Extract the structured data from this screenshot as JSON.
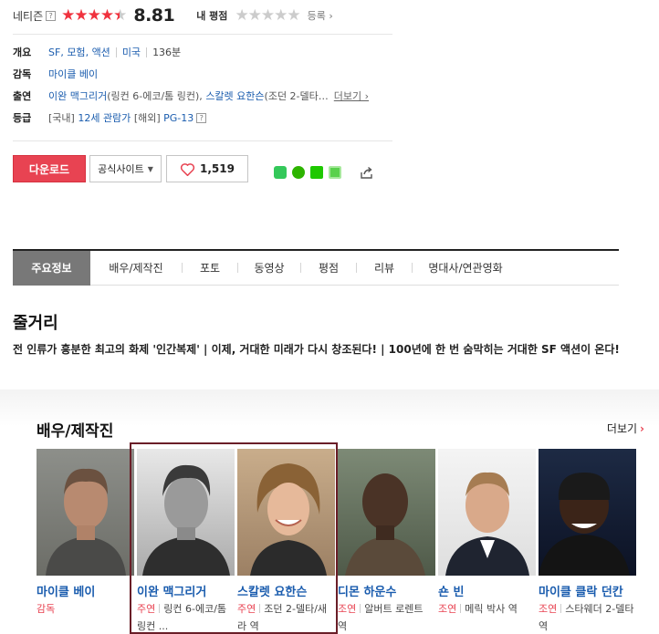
{
  "rating": {
    "netizen_label": "네티즌",
    "help_glyph": "?",
    "stars_on": "★★★★",
    "stars_half": "★",
    "stars_off": "",
    "score": "8.81",
    "my_rating_label": "내 평점",
    "my_stars": "★★★★★",
    "register_label": "등록 ›"
  },
  "info": {
    "overview_label": "개요",
    "genres": [
      "SF",
      "모험",
      "액션"
    ],
    "country": "미국",
    "runtime": "136분",
    "director_label": "감독",
    "director": "마이클 베이",
    "cast_label": "출연",
    "cast_1_name": "이완 맥그리거",
    "cast_1_role": "(링컨 6-에코/톰 링컨),",
    "cast_2_name": "스칼렛 요한슨",
    "cast_2_role": "(조던 2-델타…",
    "more_label": "더보기 ›",
    "grade_label": "등급",
    "grade_domestic_prefix": "[국내]",
    "grade_domestic": "12세 관람가",
    "grade_foreign_prefix": "[해외]",
    "grade_foreign": "PG-13"
  },
  "actions": {
    "download_label": "다운로드",
    "official_site_label": "공식사이트",
    "like_count": "1,519"
  },
  "tabs": [
    {
      "label": "주요정보",
      "active": true
    },
    {
      "label": "배우/제작진"
    },
    {
      "label": "포토"
    },
    {
      "label": "동영상"
    },
    {
      "label": "평점"
    },
    {
      "label": "리뷰"
    },
    {
      "label": "명대사/연관영화"
    }
  ],
  "synopsis": {
    "title": "줄거리",
    "text": "전 인류가 흥분한 최고의 화제 '인간복제' | 이제, 거대한 미래가 다시 창조된다! | 100년에 한 번 숨막히는 거대한 SF 액션이 온다!"
  },
  "cast_section": {
    "title": "배우/제작진",
    "more_label": "더보기",
    "members": [
      {
        "name": "마이클 베이",
        "type": "감독",
        "role": ""
      },
      {
        "name": "이완 맥그리거",
        "type": "주연",
        "role": "링컨 6-에코/톰 링컨 ..."
      },
      {
        "name": "스칼렛 요한슨",
        "type": "주연",
        "role": "조던 2-델타/새라 역"
      },
      {
        "name": "디몬 하운수",
        "type": "조연",
        "role": "알버트 로렌트 역"
      },
      {
        "name": "숀 빈",
        "type": "조연",
        "role": "메릭 박사 역"
      },
      {
        "name": "마이클 클락 던칸",
        "type": "조연",
        "role": "스타웨더 2-델타 역"
      }
    ]
  },
  "colors": {
    "accent_red": "#e84352",
    "link_blue": "#1a5cae",
    "tab_active_bg": "#787878",
    "highlight_border": "#6a1e28"
  }
}
